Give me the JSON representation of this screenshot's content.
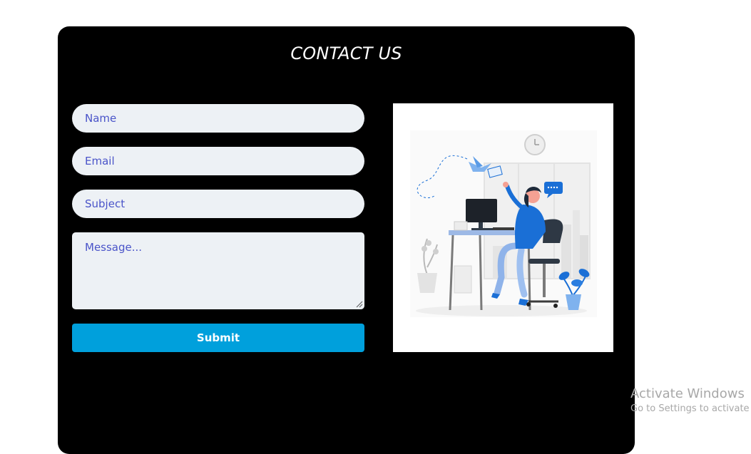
{
  "contact": {
    "title": "CONTACT US",
    "name_placeholder": "Name",
    "email_placeholder": "Email",
    "subject_placeholder": "Subject",
    "message_placeholder": "Message...",
    "submit_label": "Submit"
  },
  "illustration": {
    "icon": "office-worker-illustration",
    "accent_color": "#1a6fd6"
  },
  "watermark": {
    "line1": "Activate Windows",
    "line2": "Go to Settings to activate"
  }
}
